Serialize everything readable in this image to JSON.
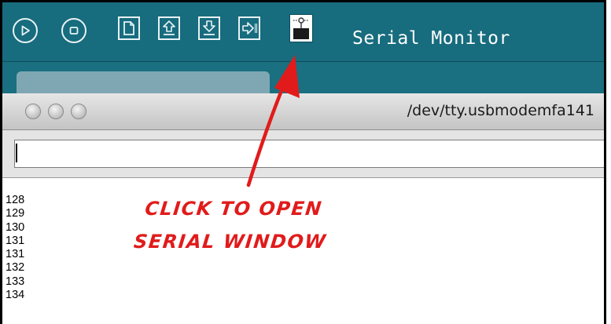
{
  "toolbar": {
    "buttons": [
      {
        "name": "run-button",
        "icon": "play-icon"
      },
      {
        "name": "stop-button",
        "icon": "stop-icon"
      },
      {
        "name": "new-button",
        "icon": "new-file-icon"
      },
      {
        "name": "open-button",
        "icon": "upload-arrow-icon"
      },
      {
        "name": "save-button",
        "icon": "download-arrow-icon"
      },
      {
        "name": "export-button",
        "icon": "export-arrow-icon"
      },
      {
        "name": "serial-monitor-button",
        "icon": "serial-monitor-icon"
      }
    ],
    "title": "Serial Monitor",
    "background": "#176c7e"
  },
  "window": {
    "title": "/dev/tty.usbmodemfa141",
    "input_value": ""
  },
  "output_lines": [
    "128",
    "129",
    "130",
    "131",
    "131",
    "132",
    "133",
    "134"
  ],
  "annotation": {
    "line1": "CLICK TO OPEN",
    "line2": "SERIAL WINDOW",
    "color": "#e11b1b"
  }
}
